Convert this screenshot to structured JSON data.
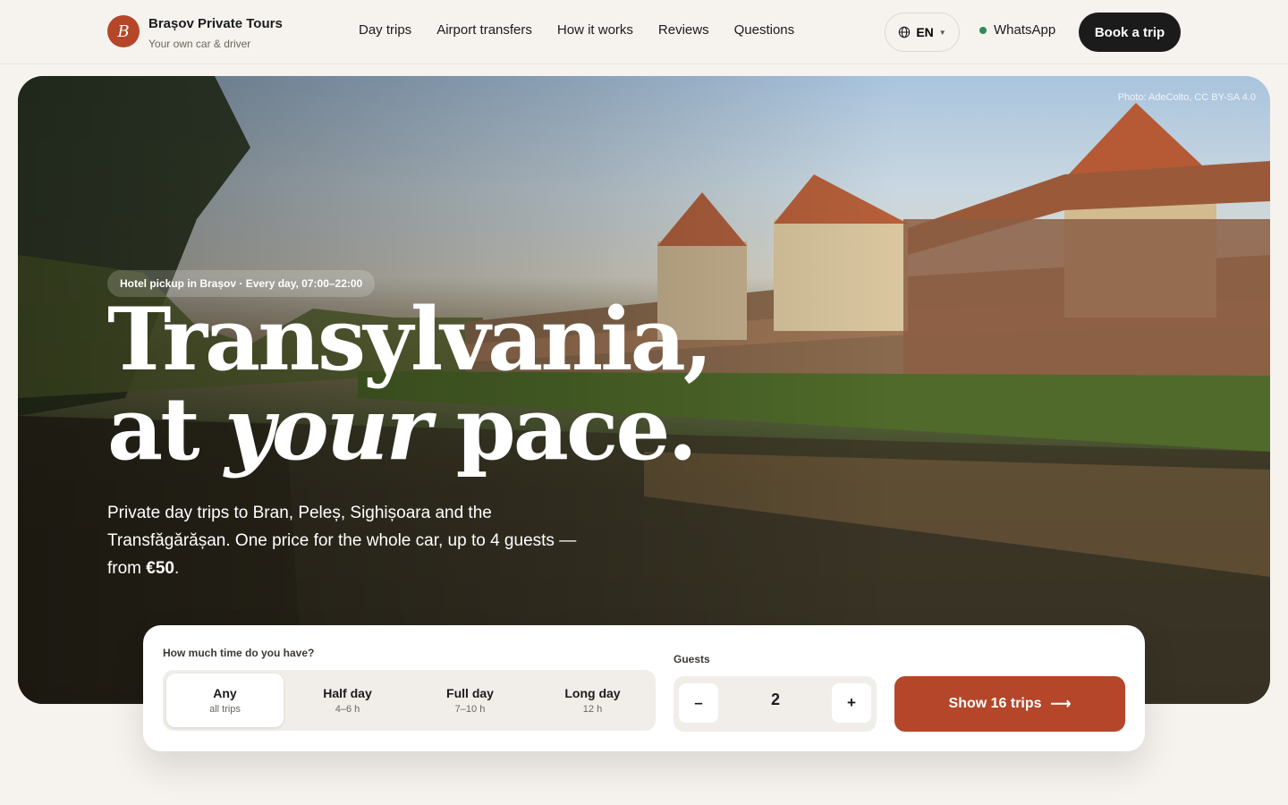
{
  "brand": {
    "initial": "B",
    "name": "Brașov Private Tours",
    "tagline": "Your own car & driver"
  },
  "nav": [
    "Day trips",
    "Airport transfers",
    "How it works",
    "Reviews",
    "Questions"
  ],
  "header": {
    "language": "EN",
    "whatsapp": "WhatsApp",
    "book_label": "Book a trip"
  },
  "hero": {
    "credit": "Photo: AdeColto, CC BY-SA 4.0",
    "pill": "Hotel pickup in Brașov · Every day, 07:00–22:00",
    "title_line1": "Transylvania,",
    "title_line2_a": "at ",
    "title_line2_em": "your",
    "title_line2_b": " pace.",
    "lede_text": "Private day trips to Bran, Peleș, Sighișoara and the Transfăgărășan. One price for the whole car, up to 4 guests — from ",
    "lede_price": "€50",
    "lede_end": "."
  },
  "filter": {
    "time_label": "How much time do you have?",
    "options": [
      {
        "title": "Any",
        "sub": "all trips"
      },
      {
        "title": "Half day",
        "sub": "4–6 h"
      },
      {
        "title": "Full day",
        "sub": "7–10 h"
      },
      {
        "title": "Long day",
        "sub": "12 h"
      }
    ],
    "guests_label": "Guests",
    "decrement": "–",
    "increment": "+",
    "guests": "2",
    "show_label": "Show 16 trips",
    "show_arrow": "⟶"
  },
  "colors": {
    "accent": "#b5462a",
    "dark": "#1b1b1b",
    "background": "#f6f3ee",
    "whatsapp_dot": "#2e8b57"
  },
  "icons": {
    "language": "globe-icon",
    "status": "online-dot-icon",
    "cta": "arrow-right-icon"
  }
}
